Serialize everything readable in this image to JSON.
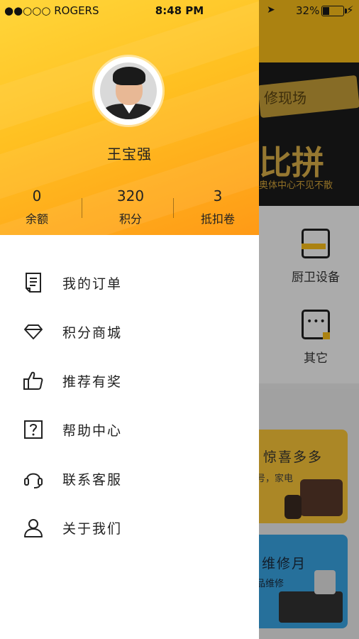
{
  "status_bar": {
    "carrier": "●●○○○ ROGERS",
    "time": "8:48 PM",
    "battery": "32%"
  },
  "drawer": {
    "username": "王宝强",
    "stats": [
      {
        "value": "0",
        "label": "余额"
      },
      {
        "value": "320",
        "label": "积分"
      },
      {
        "value": "3",
        "label": "抵扣卷"
      }
    ],
    "menu": [
      {
        "label": "我的订单",
        "icon": "order-icon"
      },
      {
        "label": "积分商城",
        "icon": "diamond-icon"
      },
      {
        "label": "推荐有奖",
        "icon": "thumbs-up-icon"
      },
      {
        "label": "帮助中心",
        "icon": "help-icon"
      },
      {
        "label": "联系客服",
        "icon": "headset-icon"
      },
      {
        "label": "关于我们",
        "icon": "user-icon"
      }
    ]
  },
  "background": {
    "banner_top": "修现场",
    "banner_main": "比拼",
    "banner_sub": "奥体中心不见不散",
    "categories": [
      {
        "label": "厨卫设备",
        "icon": "toilet-icon"
      },
      {
        "label": "其它",
        "icon": "more-icon"
      }
    ],
    "cards": [
      {
        "title": "惊喜多多",
        "subtitle": "号，家电"
      },
      {
        "title": "维修月",
        "subtitle": "品维修"
      }
    ]
  },
  "colors": {
    "accent": "#ffc21a",
    "header_gradient_start": "#ffd63a",
    "header_gradient_end": "#ff9a16"
  }
}
